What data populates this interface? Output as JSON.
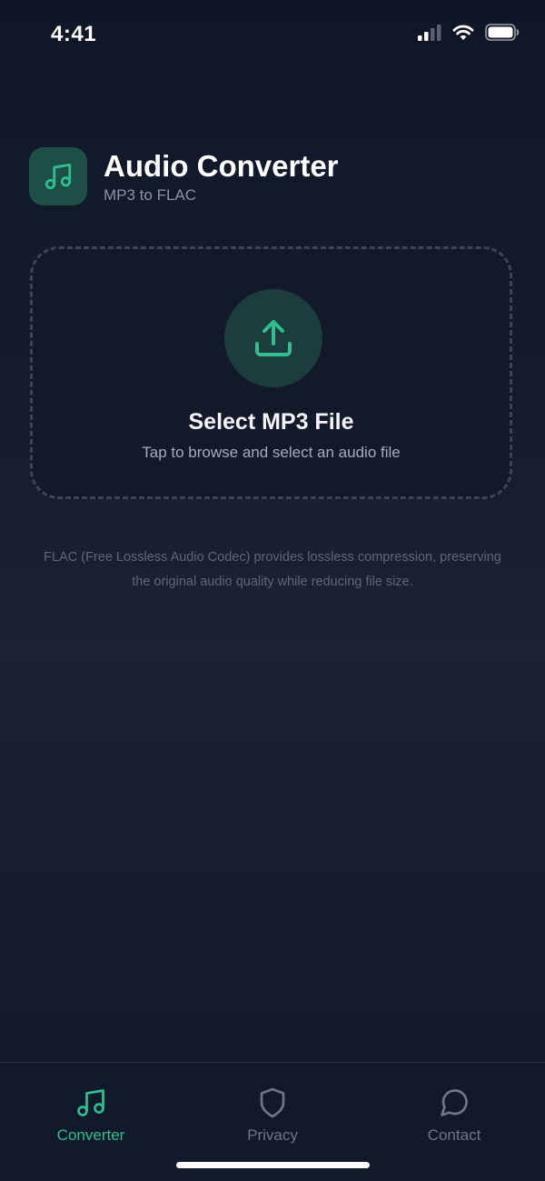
{
  "status_bar": {
    "time": "4:41"
  },
  "header": {
    "title": "Audio Converter",
    "subtitle": "MP3 to FLAC",
    "icon": "music-note-icon"
  },
  "dropzone": {
    "title": "Select MP3 File",
    "subtitle": "Tap to browse and select an audio file",
    "icon": "upload-icon"
  },
  "info": {
    "text": "FLAC (Free Lossless Audio Codec) provides lossless compression, preserving the original audio quality while reducing file size."
  },
  "tabs": [
    {
      "label": "Converter",
      "icon": "music-note-icon",
      "active": true
    },
    {
      "label": "Privacy",
      "icon": "shield-icon",
      "active": false
    },
    {
      "label": "Contact",
      "icon": "chat-bubble-icon",
      "active": false
    }
  ],
  "colors": {
    "accent": "#2fbf8f",
    "background": "#141d2e",
    "inactive": "#6e7688"
  }
}
